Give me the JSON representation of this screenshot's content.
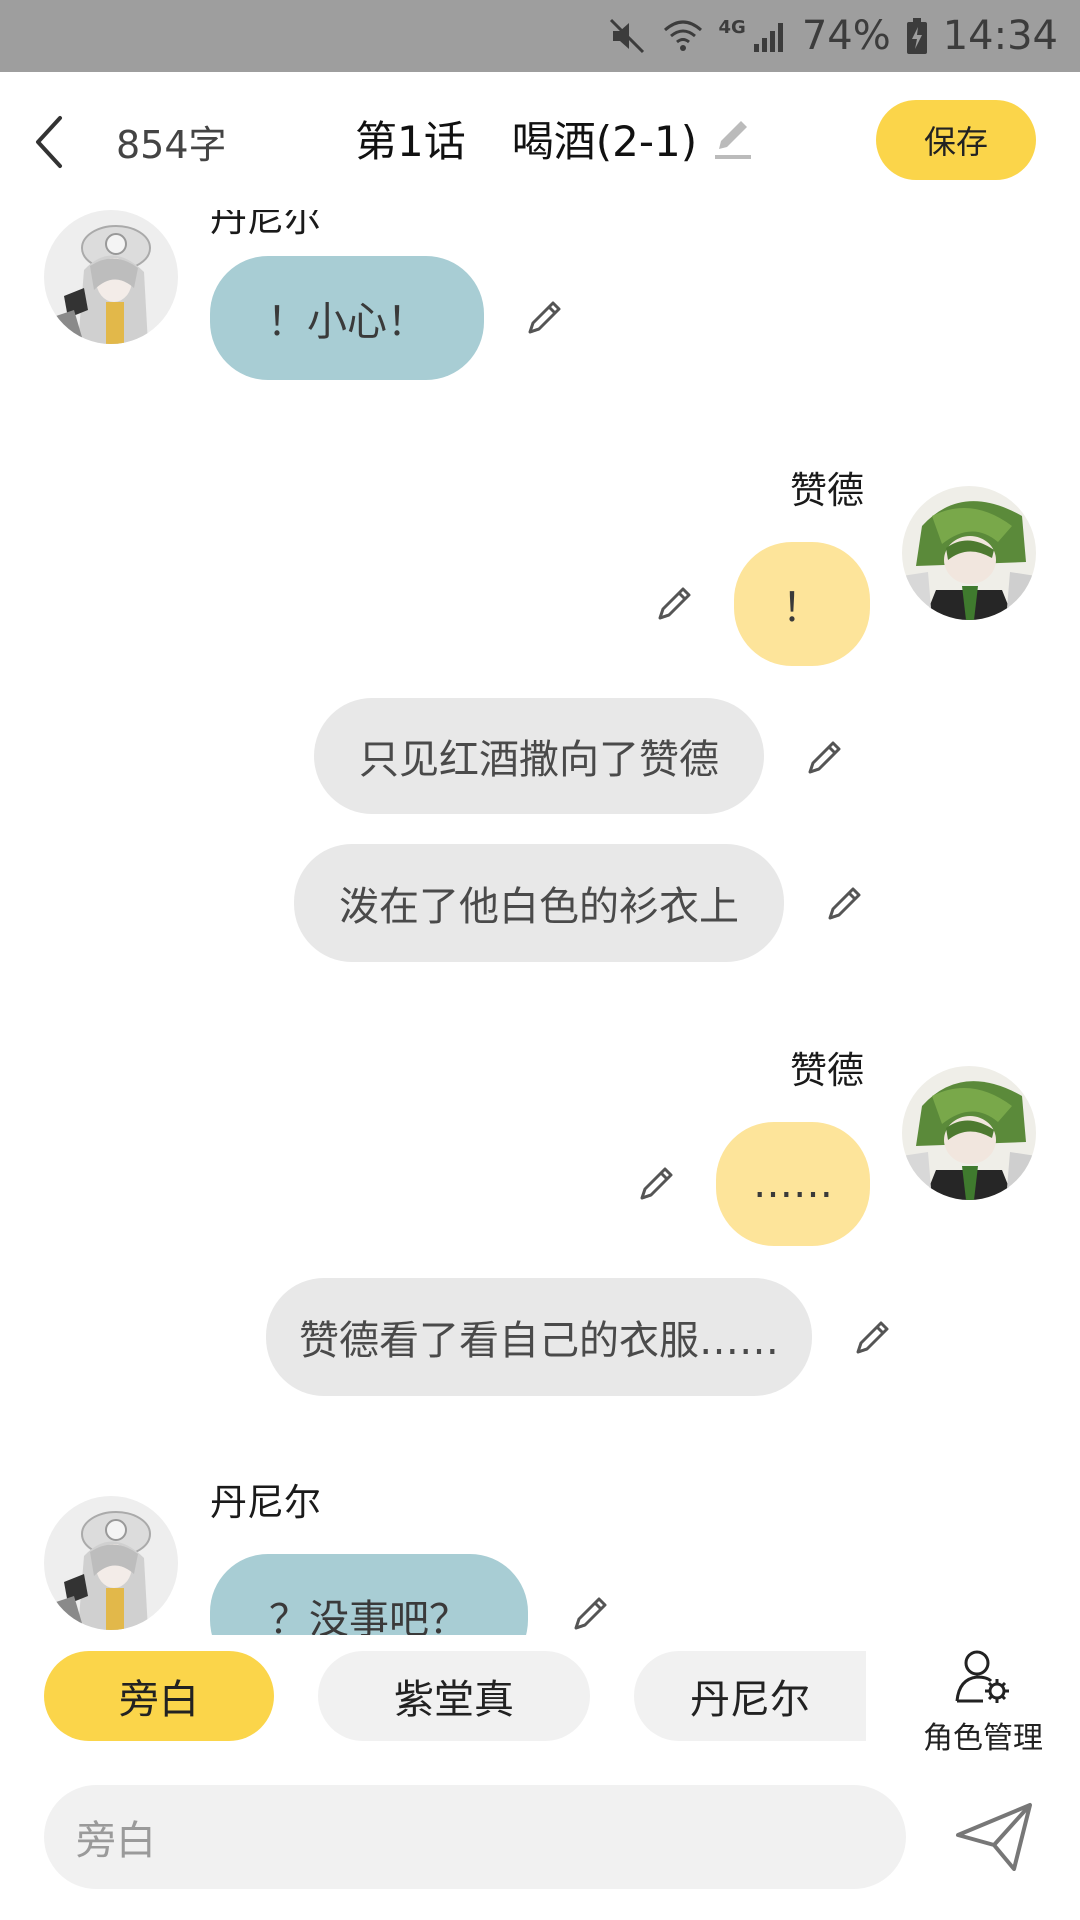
{
  "status_bar": {
    "network": "4G",
    "battery": "74%",
    "time": "14:34"
  },
  "header": {
    "word_count": "854字",
    "episode": "第1话",
    "title": "喝酒(2-1)",
    "save_label": "保存"
  },
  "messages": [
    {
      "type": "left",
      "sender": "丹尼尔",
      "text": "！小心！"
    },
    {
      "type": "right",
      "sender": "赞德",
      "text": "！"
    },
    {
      "type": "narration",
      "text": "只见红酒撒向了赞德"
    },
    {
      "type": "narration",
      "text": "泼在了他白色的衫衣上"
    },
    {
      "type": "right",
      "sender": "赞德",
      "text": "……"
    },
    {
      "type": "narration",
      "text": "赞德看了看自己的衣服……"
    },
    {
      "type": "left",
      "sender": "丹尼尔",
      "text": "？没事吧？"
    }
  ],
  "roles": [
    {
      "label": "旁白",
      "active": true
    },
    {
      "label": "紫堂真",
      "active": false
    },
    {
      "label": "丹尼尔",
      "active": false
    }
  ],
  "role_manage_label": "角色管理",
  "input": {
    "placeholder": "旁白"
  },
  "colors": {
    "accent": "#fbd54a",
    "left_bubble": "#a8cdd4",
    "right_bubble": "#fde49a",
    "narration_bubble": "#e8e8e8"
  }
}
